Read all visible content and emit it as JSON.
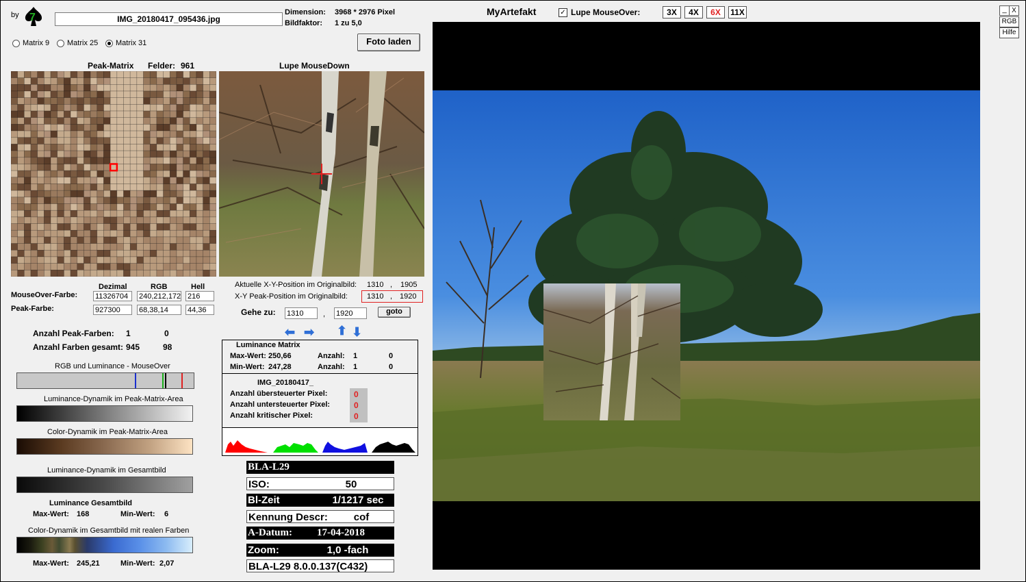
{
  "header": {
    "by": "by",
    "filename": "IMG_20180417_095436.jpg",
    "dimension_label": "Dimension:",
    "dimension_value": "3968 * 2976 Pixel",
    "factor_label": "Bildfaktor:",
    "factor_value": "1 zu 5,0",
    "app_title": "MyArtefakt",
    "lupe_label": "Lupe MouseOver:",
    "zoom_buttons": [
      "3X",
      "4X",
      "6X",
      "11X"
    ],
    "win_min": "_",
    "win_close": "X",
    "rgb_btn": "RGB",
    "hilfe_btn": "Hilfe"
  },
  "matrix_options": [
    "Matrix 9",
    "Matrix 25",
    "Matrix 31"
  ],
  "foto_laden": "Foto laden",
  "peak_matrix": {
    "title": "Peak-Matrix",
    "felder_label": "Felder:",
    "felder_value": "961"
  },
  "lupe_title": "Lupe MouseDown",
  "color_table": {
    "headers": [
      "Dezimal",
      "RGB",
      "Hell"
    ],
    "mouseover_label": "MouseOver-Farbe:",
    "mouseover": [
      "11326704",
      "240,212,172",
      "216"
    ],
    "peak_label": "Peak-Farbe:",
    "peak": [
      "927300",
      "68,38,14",
      "44,36"
    ]
  },
  "positions": {
    "current_label": "Aktuelle X-Y-Position  im Originalbild:",
    "current_x": "1310",
    "current_y": "1905",
    "peak_label": "X-Y Peak-Position  im Originalbild:",
    "peak_x": "1310",
    "peak_y": "1920",
    "goto_label": "Gehe zu:",
    "goto_x": "1310",
    "goto_y": "1920",
    "goto_btn": "goto",
    "comma": ","
  },
  "counts": {
    "peak_label": "Anzahl Peak-Farben:",
    "peak_a": "1",
    "peak_b": "0",
    "total_label": "Anzahl Farben gesamt:",
    "total_a": "945",
    "total_b": "98"
  },
  "bars": {
    "rgb_lum": "RGB und Luminance - MouseOver",
    "lum_peak": "Luminance-Dynamik im Peak-Matrix-Area",
    "color_peak": "Color-Dynamik im Peak-Matrix-Area",
    "lum_total": "Luminance-Dynamik im Gesamtbild",
    "lum_total_title": "Luminance Gesamtbild",
    "lum_max_label": "Max-Wert:",
    "lum_max": "168",
    "lum_min_label": "Min-Wert:",
    "lum_min": "6",
    "color_total": "Color-Dynamik im Gesamtbild mit realen Farben",
    "color_max_label": "Max-Wert:",
    "color_max": "245,21",
    "color_min_label": "Min-Wert:",
    "color_min": "2,07"
  },
  "lum_matrix": {
    "title": "Luminance Matrix",
    "max_label": "Max-Wert:",
    "max": "250,66",
    "min_label": "Min-Wert:",
    "min": "247,28",
    "anzahl": "Anzahl:",
    "max_count_a": "1",
    "max_count_b": "0",
    "min_count_a": "1",
    "min_count_b": "0"
  },
  "pixel_stats": {
    "name": "IMG_20180417_",
    "over_label": "Anzahl übersteuerter Pixel:",
    "under_label": "Anzahl untersteuerter Pixel:",
    "crit_label": "Anzahl kritischer Pixel:",
    "over": "0",
    "under": "0",
    "crit": "0"
  },
  "exif": {
    "model": "BLA-L29",
    "iso_label": "ISO:",
    "iso": "50",
    "bl_label": "Bl-Zeit",
    "bl": "1/1217 sec",
    "kennung_label": "Kennung Descr:",
    "kennung": "cof",
    "datum_label": "A-Datum:",
    "datum": "17-04-2018",
    "zoom_label": "Zoom:",
    "zoom": "1,0 -fach",
    "firmware": "BLA-L29 8.0.0.137(C432)"
  },
  "colors": {
    "zoom_active": "#e02020",
    "peak_marker": "#ff0000",
    "stat_zero": "#e02020"
  }
}
